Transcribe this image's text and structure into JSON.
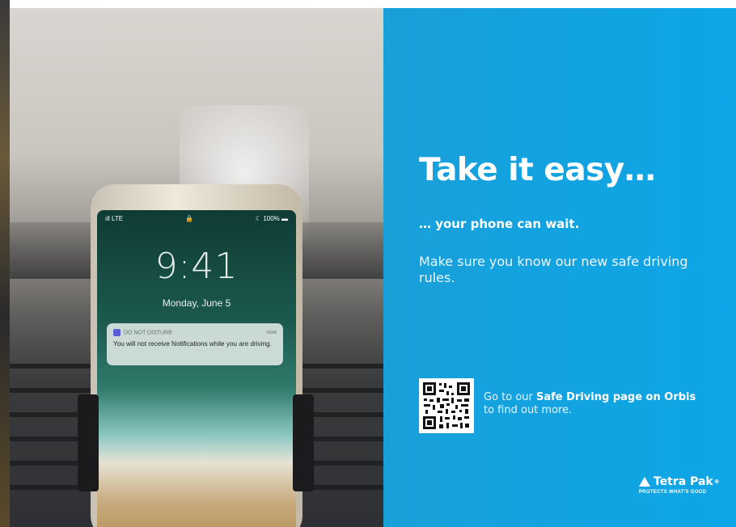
{
  "phone": {
    "status_left": "ıll LTE",
    "status_lock": "🔒",
    "status_right": "☾ 100% ▬",
    "time": "9:41",
    "date": "Monday, June 5",
    "notification": {
      "app": "DO NOT DISTURB",
      "when": "now",
      "message": "You will not receive Notifications while you are driving."
    }
  },
  "headline": "Take it easy…",
  "subheadline": "… your phone can wait.",
  "body": "Make sure you know our new safe driving rules.",
  "cta": {
    "prefix": "Go to our ",
    "link": "Safe Driving page on Orbis",
    "suffix": "to find out more."
  },
  "logo": {
    "name": "Tetra Pak",
    "reg": "®",
    "tagline": "PROTECTS WHAT'S GOOD"
  },
  "colors": {
    "accent": "#0ea6e6",
    "text": "#ffffff"
  }
}
